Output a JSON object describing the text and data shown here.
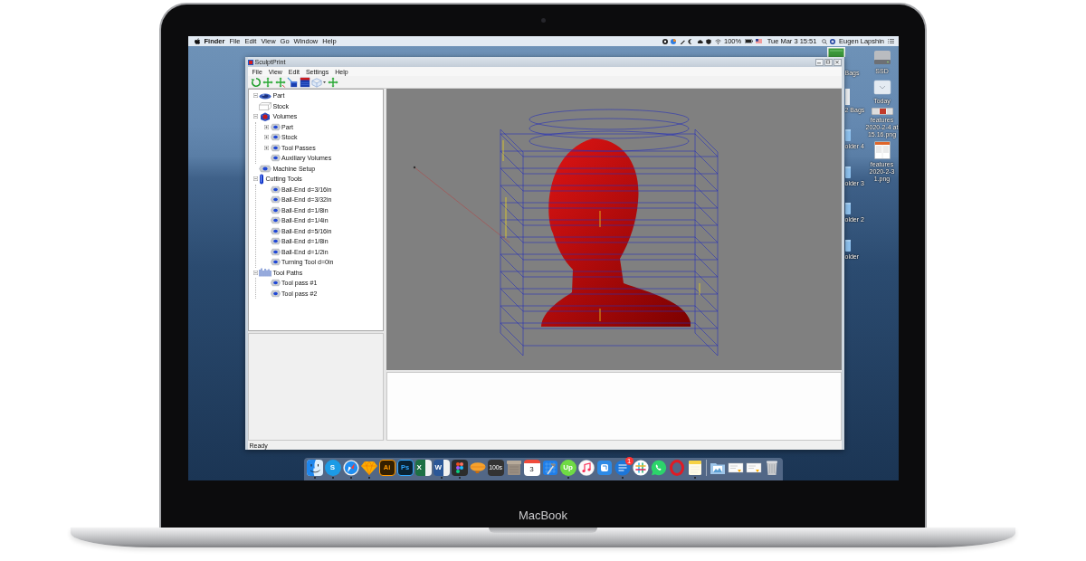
{
  "device": {
    "label": "MacBook"
  },
  "menu_bar": {
    "app_name": "Finder",
    "menus": [
      "File",
      "Edit",
      "View",
      "Go",
      "Window",
      "Help"
    ],
    "battery": "100%",
    "clock": "Tue Mar 3 15:51",
    "user": "Eugen Lapshin"
  },
  "app_window": {
    "title": "SculptPrint",
    "menus": [
      "File",
      "View",
      "Edit",
      "Settings",
      "Help"
    ],
    "tree": [
      {
        "label": "Part",
        "kind": "part",
        "expanded": true
      },
      {
        "label": "Stock",
        "kind": "stock"
      },
      {
        "label": "Volumes",
        "kind": "volumes",
        "expanded": true,
        "children": [
          {
            "label": "Part",
            "kind": "item",
            "expanded": false
          },
          {
            "label": "Stock",
            "kind": "item",
            "expanded": false
          },
          {
            "label": "Tool Passes",
            "kind": "item",
            "expanded": false
          },
          {
            "label": "Auxiliary Volumes",
            "kind": "item"
          }
        ]
      },
      {
        "label": "Machine Setup",
        "kind": "setup"
      },
      {
        "label": "Cutting Tools",
        "kind": "tools",
        "expanded": true,
        "children": [
          {
            "label": "Ball-End d=3/16in",
            "kind": "item"
          },
          {
            "label": "Ball-End d=3/32in",
            "kind": "item"
          },
          {
            "label": "Ball-End d=1/8in",
            "kind": "item"
          },
          {
            "label": "Ball-End d=1/4in",
            "kind": "item"
          },
          {
            "label": "Ball-End d=5/16in",
            "kind": "item"
          },
          {
            "label": "Ball-End d=1/8in",
            "kind": "item"
          },
          {
            "label": "Ball-End d=1/2in",
            "kind": "item"
          },
          {
            "label": "Turning Tool d=0in",
            "kind": "item"
          }
        ]
      },
      {
        "label": "Tool Paths",
        "kind": "paths",
        "expanded": true,
        "children": [
          {
            "label": "Tool pass #1",
            "kind": "item"
          },
          {
            "label": "Tool pass #2",
            "kind": "item"
          }
        ]
      }
    ],
    "status_bar": "Ready"
  },
  "desktop_icons": [
    {
      "label": "SSD",
      "kind": "drive"
    },
    {
      "label": "Today",
      "kind": "tray"
    },
    {
      "label": "features 2020-2-4 at 15.16.png",
      "kind": "strip"
    },
    {
      "label": "features 2020-2-3 1.png",
      "kind": "page"
    }
  ],
  "partly_hidden_icons": [
    {
      "label": "Bags",
      "kind": "image"
    },
    {
      "label": "2 Bags",
      "kind": "document"
    },
    {
      "label": "older 4",
      "kind": "folder"
    },
    {
      "label": "older 3",
      "kind": "folder"
    },
    {
      "label": "older 2",
      "kind": "folder"
    },
    {
      "label": "older",
      "kind": "folder"
    }
  ],
  "dock": {
    "apps": [
      {
        "kind": "face",
        "running": true
      },
      {
        "kind": "letter-disc",
        "glyph": "S",
        "color": "#1c9be6",
        "running": true
      },
      {
        "kind": "compass",
        "running": true
      },
      {
        "kind": "gem",
        "running": true
      },
      {
        "kind": "letter-tile",
        "glyph": "Ai",
        "color": "#ff9a00",
        "running": false
      },
      {
        "kind": "letter-tile",
        "glyph": "Ps",
        "color": "#31a8ff",
        "running": false
      },
      {
        "kind": "sheet-letter",
        "glyph": "X",
        "color": "#1d7044",
        "running": false
      },
      {
        "kind": "sheet-letter",
        "glyph": "W",
        "color": "#2b5797",
        "running": true
      },
      {
        "kind": "shapes",
        "running": true
      },
      {
        "kind": "blimp",
        "running": false
      },
      {
        "kind": "dark-tile",
        "glyph": "100s",
        "running": false
      },
      {
        "kind": "box",
        "running": false
      },
      {
        "kind": "calendar",
        "glyph": "3",
        "running": false
      },
      {
        "kind": "hammer",
        "running": false
      },
      {
        "kind": "letter-disc",
        "glyph": "Up",
        "color": "#6fda44",
        "running": true
      },
      {
        "kind": "note-disc",
        "running": false
      },
      {
        "kind": "square-tile",
        "running": false
      },
      {
        "kind": "bubble",
        "badge": "1",
        "running": true
      },
      {
        "kind": "hash-disc",
        "running": false
      },
      {
        "kind": "phone-bubble",
        "running": false
      },
      {
        "kind": "ring",
        "running": false
      },
      {
        "kind": "notepad",
        "running": true
      }
    ],
    "stacks": [
      {
        "kind": "folder-stack"
      },
      {
        "kind": "doc-stack"
      },
      {
        "kind": "doc-stack"
      },
      {
        "kind": "trash"
      }
    ]
  }
}
